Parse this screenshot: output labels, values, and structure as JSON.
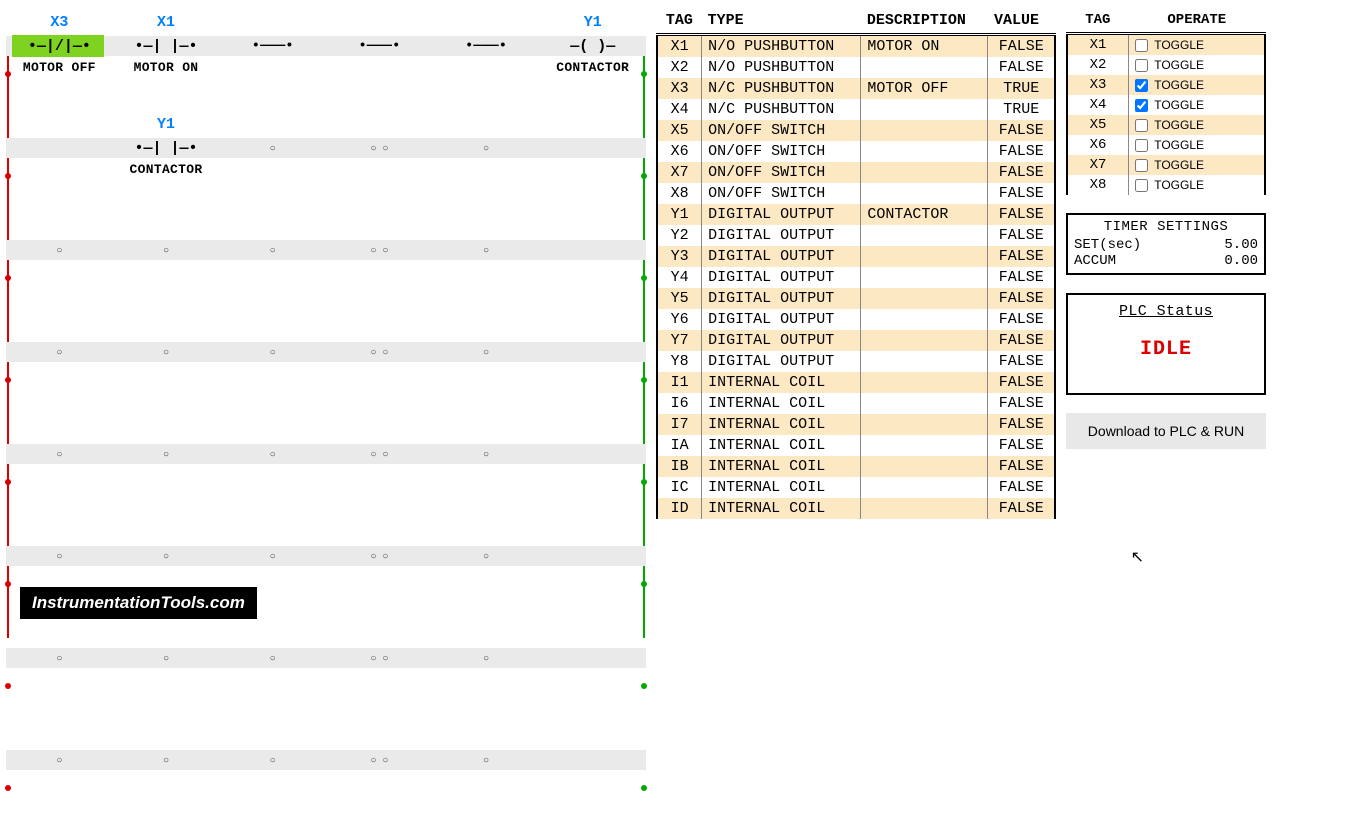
{
  "ladder": {
    "rung1": {
      "slot1": {
        "label_top": "X3",
        "symbol": "•—|/|—•",
        "label_bot": "MOTOR OFF"
      },
      "slot2": {
        "label_top": "X1",
        "symbol": "•—| |—•",
        "label_bot": "MOTOR ON"
      },
      "slot3": {
        "symbol": "•———•"
      },
      "slot4": {
        "symbol": "•———•"
      },
      "slot5": {
        "symbol": "•———•"
      },
      "slot6": {
        "label_top": "Y1",
        "symbol": "—( )—",
        "label_bot": "CONTACTOR"
      }
    },
    "rung2": {
      "slot2": {
        "label_top": "Y1",
        "symbol": "•—| |—•",
        "label_bot": "CONTACTOR"
      }
    }
  },
  "tag_table": {
    "headers": {
      "tag": "TAG",
      "type": "TYPE",
      "desc": "DESCRIPTION",
      "val": "VALUE"
    },
    "rows": [
      {
        "tag": "X1",
        "type": "N/O PUSHBUTTON",
        "desc": "MOTOR ON",
        "val": "FALSE"
      },
      {
        "tag": "X2",
        "type": "N/O PUSHBUTTON",
        "desc": "",
        "val": "FALSE"
      },
      {
        "tag": "X3",
        "type": "N/C PUSHBUTTON",
        "desc": "MOTOR OFF",
        "val": "TRUE"
      },
      {
        "tag": "X4",
        "type": "N/C PUSHBUTTON",
        "desc": "",
        "val": "TRUE"
      },
      {
        "tag": "X5",
        "type": "ON/OFF SWITCH",
        "desc": "",
        "val": "FALSE"
      },
      {
        "tag": "X6",
        "type": "ON/OFF SWITCH",
        "desc": "",
        "val": "FALSE"
      },
      {
        "tag": "X7",
        "type": "ON/OFF SWITCH",
        "desc": "",
        "val": "FALSE"
      },
      {
        "tag": "X8",
        "type": "ON/OFF SWITCH",
        "desc": "",
        "val": "FALSE"
      },
      {
        "tag": "Y1",
        "type": "DIGITAL OUTPUT",
        "desc": "CONTACTOR",
        "val": "FALSE"
      },
      {
        "tag": "Y2",
        "type": "DIGITAL OUTPUT",
        "desc": "",
        "val": "FALSE"
      },
      {
        "tag": "Y3",
        "type": "DIGITAL OUTPUT",
        "desc": "",
        "val": "FALSE"
      },
      {
        "tag": "Y4",
        "type": "DIGITAL OUTPUT",
        "desc": "",
        "val": "FALSE"
      },
      {
        "tag": "Y5",
        "type": "DIGITAL OUTPUT",
        "desc": "",
        "val": "FALSE"
      },
      {
        "tag": "Y6",
        "type": "DIGITAL OUTPUT",
        "desc": "",
        "val": "FALSE"
      },
      {
        "tag": "Y7",
        "type": "DIGITAL OUTPUT",
        "desc": "",
        "val": "FALSE"
      },
      {
        "tag": "Y8",
        "type": "DIGITAL OUTPUT",
        "desc": "",
        "val": "FALSE"
      },
      {
        "tag": "I1",
        "type": "INTERNAL COIL",
        "desc": "",
        "val": "FALSE"
      },
      {
        "tag": "I6",
        "type": "INTERNAL COIL",
        "desc": "",
        "val": "FALSE"
      },
      {
        "tag": "I7",
        "type": "INTERNAL COIL",
        "desc": "",
        "val": "FALSE"
      },
      {
        "tag": "IA",
        "type": "INTERNAL COIL",
        "desc": "",
        "val": "FALSE"
      },
      {
        "tag": "IB",
        "type": "INTERNAL COIL",
        "desc": "",
        "val": "FALSE"
      },
      {
        "tag": "IC",
        "type": "INTERNAL COIL",
        "desc": "",
        "val": "FALSE"
      },
      {
        "tag": "ID",
        "type": "INTERNAL COIL",
        "desc": "",
        "val": "FALSE"
      }
    ]
  },
  "operate_table": {
    "headers": {
      "tag": "TAG",
      "operate": "OPERATE"
    },
    "toggle_label": "TOGGLE",
    "rows": [
      {
        "tag": "X1",
        "checked": false
      },
      {
        "tag": "X2",
        "checked": false
      },
      {
        "tag": "X3",
        "checked": true
      },
      {
        "tag": "X4",
        "checked": true
      },
      {
        "tag": "X5",
        "checked": false
      },
      {
        "tag": "X6",
        "checked": false
      },
      {
        "tag": "X7",
        "checked": false
      },
      {
        "tag": "X8",
        "checked": false
      }
    ]
  },
  "timer": {
    "title": "TIMER SETTINGS",
    "set_label": "SET(sec)",
    "set_value": "5.00",
    "accum_label": "ACCUM",
    "accum_value": "0.00"
  },
  "plc_status": {
    "title": "PLC Status",
    "state": "IDLE"
  },
  "download_btn": "Download to PLC & RUN",
  "watermark": "InstrumentationTools.com"
}
